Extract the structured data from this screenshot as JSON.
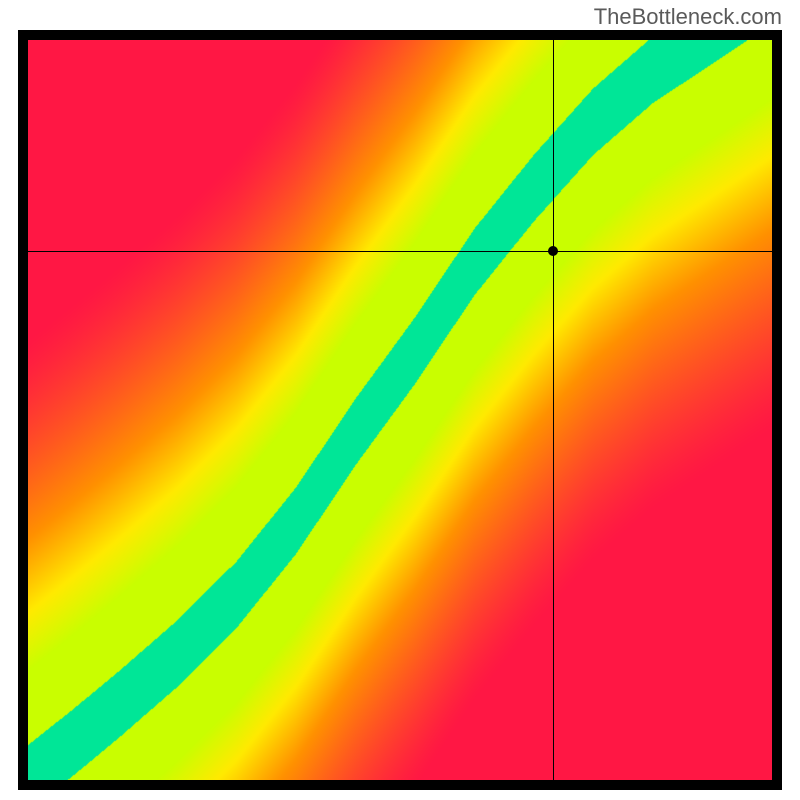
{
  "watermark": "TheBottleneck.com",
  "chart_data": {
    "type": "heatmap",
    "title": "",
    "xlabel": "",
    "ylabel": "",
    "xlim": [
      0,
      100
    ],
    "ylim": [
      0,
      100
    ],
    "crosshair": {
      "x": 70.5,
      "y": 71.5
    },
    "marker": {
      "x": 70.5,
      "y": 71.5
    },
    "colorscale": [
      {
        "value": 0.0,
        "color": "#ff1744"
      },
      {
        "value": 0.4,
        "color": "#ff9100"
      },
      {
        "value": 0.6,
        "color": "#ffea00"
      },
      {
        "value": 0.78,
        "color": "#c6ff00"
      },
      {
        "value": 1.0,
        "color": "#00e697"
      }
    ],
    "optimal_curve_points": [
      {
        "x": 1,
        "y": 1
      },
      {
        "x": 6,
        "y": 5
      },
      {
        "x": 12,
        "y": 10
      },
      {
        "x": 20,
        "y": 17
      },
      {
        "x": 28,
        "y": 25
      },
      {
        "x": 36,
        "y": 35
      },
      {
        "x": 44,
        "y": 47
      },
      {
        "x": 52,
        "y": 58
      },
      {
        "x": 60,
        "y": 70
      },
      {
        "x": 68,
        "y": 80
      },
      {
        "x": 76,
        "y": 89
      },
      {
        "x": 84,
        "y": 96
      },
      {
        "x": 90,
        "y": 100
      }
    ],
    "band_half_width_percent": 4.5
  }
}
